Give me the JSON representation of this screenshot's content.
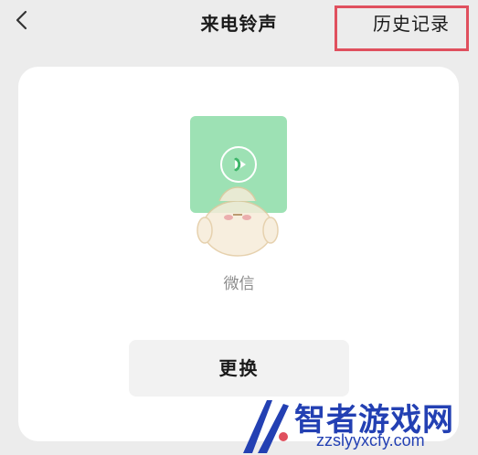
{
  "nav": {
    "back_icon": "chevron-left-icon",
    "title": "来电铃声",
    "history_label": "历史记录"
  },
  "annotation": {
    "color": "#e0505e"
  },
  "ringtone": {
    "cover_color": "#9de1b4",
    "play_icon": "play-icon",
    "name": "微信"
  },
  "actions": {
    "change_label": "更换"
  },
  "watermark": {
    "title": "智者游戏网",
    "subtitle": "zzslyyxcfy.com"
  }
}
